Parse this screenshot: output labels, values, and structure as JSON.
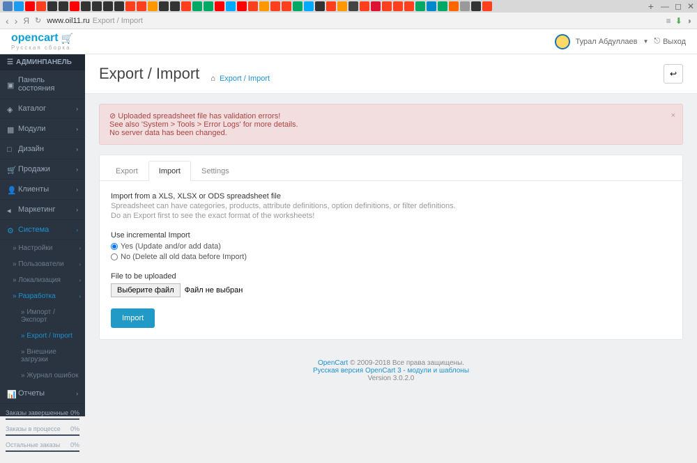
{
  "browser": {
    "host": "www.oil11.ru",
    "path": "Export / Import"
  },
  "header": {
    "logo": "opencart",
    "logo_sub": "Русская сборка",
    "user": "Турал Абдуллаев",
    "logout": "Выход"
  },
  "sidebar": {
    "title": "АДМИНПАНЕЛЬ",
    "items": [
      {
        "label": "Панель состояния",
        "icon": "dashboard",
        "expand": false
      },
      {
        "label": "Каталог",
        "icon": "tag",
        "expand": true
      },
      {
        "label": "Модули",
        "icon": "puzzle",
        "expand": true
      },
      {
        "label": "Дизайн",
        "icon": "screen",
        "expand": true
      },
      {
        "label": "Продажи",
        "icon": "cart",
        "expand": true
      },
      {
        "label": "Клиенты",
        "icon": "user",
        "expand": true
      },
      {
        "label": "Маркетинг",
        "icon": "share",
        "expand": true
      },
      {
        "label": "Система",
        "icon": "gear",
        "expand": true,
        "active": true
      },
      {
        "label": "Отчеты",
        "icon": "stats",
        "expand": true
      }
    ],
    "subs": [
      {
        "label": "Настройки",
        "expand": true
      },
      {
        "label": "Пользователи",
        "expand": true
      },
      {
        "label": "Локализация",
        "expand": true
      },
      {
        "label": "Разработка",
        "expand": true,
        "active": true
      }
    ],
    "subs2": [
      {
        "label": "Импорт / Экспорт"
      },
      {
        "label": "Export / Import",
        "active": true
      },
      {
        "label": "Внешние загрузки"
      },
      {
        "label": "Журнал ошибок"
      }
    ],
    "stats": [
      {
        "label": "Заказы завершенные",
        "val": "0%"
      },
      {
        "label": "Заказы в процессе",
        "val": "0%"
      },
      {
        "label": "Остальные заказы",
        "val": "0%"
      }
    ]
  },
  "page": {
    "title": "Export / Import",
    "breadcrumb": "Export / Import"
  },
  "alert": {
    "l1": "Uploaded spreadsheet file has validation errors!",
    "l2": "See also 'System > Tools > Error Logs' for more details.",
    "l3": "No server data has been changed."
  },
  "tabs": {
    "export": "Export",
    "import": "Import",
    "settings": "Settings"
  },
  "form": {
    "title": "Import from a XLS, XLSX or ODS spreadsheet file",
    "help1": "Spreadsheet can have categories, products, attribute definitions, option definitions, or filter definitions.",
    "help2": "Do an Export first to see the exact format of the worksheets!",
    "incremental_label": "Use incremental Import",
    "radio_yes": "Yes (Update and/or add data)",
    "radio_no": "No (Delete all old data before Import)",
    "file_label": "File to be uploaded",
    "file_btn": "Выберите файл",
    "file_none": "Файл не выбран",
    "import_btn": "Import"
  },
  "footer": {
    "opencart": "OpenCart",
    "copyright": " © 2009-2018 Все права защищены.",
    "rus": "Русская версия OpenCart 3 - модули и шаблоны",
    "version": "Version 3.0.2.0"
  }
}
